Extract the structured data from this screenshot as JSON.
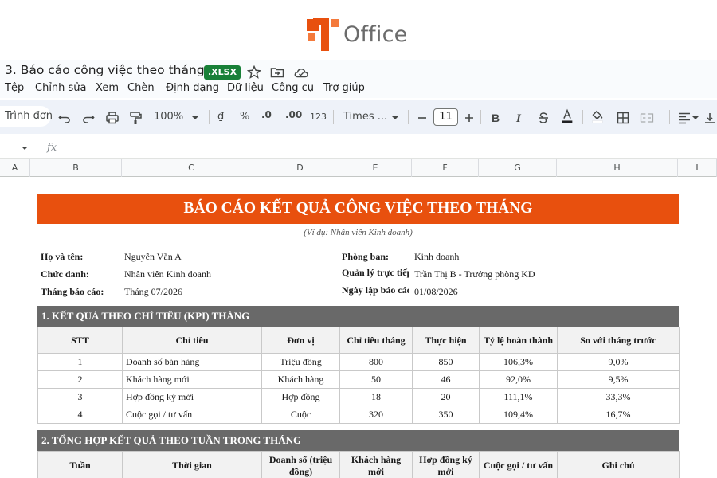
{
  "brand": {
    "name": "Office",
    "logo_color": "#e8500e"
  },
  "document": {
    "title": "3. Báo cáo công việc theo tháng",
    "badge": ".XLSX"
  },
  "menu": [
    "Tệp",
    "Chỉnh sửa",
    "Xem",
    "Chèn",
    "Định dạng",
    "Dữ liệu",
    "Công cụ",
    "Trợ giúp"
  ],
  "toolbar": {
    "mode": "Trình đơn",
    "zoom": "100%",
    "currency": "₫",
    "percent": "%",
    "dec_decrease": ".0",
    "dec_increase": ".00",
    "number_format": "123",
    "font": "Times ...",
    "font_size": "11"
  },
  "formula": {
    "fx": "fx"
  },
  "columns": [
    "A",
    "B",
    "C",
    "D",
    "E",
    "F",
    "G",
    "H",
    "I"
  ],
  "report": {
    "title": "BÁO CÁO KẾT QUẢ CÔNG VIỆC THEO THÁNG",
    "subtitle": "(Ví dụ: Nhân viên Kinh doanh)",
    "accent_color": "#e8500e",
    "info_left": [
      {
        "label": "Họ và tên:",
        "value": "Nguyễn Văn A"
      },
      {
        "label": "Chức danh:",
        "value": "Nhân viên Kinh doanh"
      },
      {
        "label": "Tháng báo cáo:",
        "value": "Tháng 07/2026"
      }
    ],
    "info_right": [
      {
        "label": "Phòng ban:",
        "value": "Kinh doanh"
      },
      {
        "label": "Quản lý trực tiếp:",
        "value": "Trần Thị B - Trưởng phòng KD"
      },
      {
        "label": "Ngày lập báo cáo:",
        "value": "01/08/2026"
      }
    ],
    "section1": {
      "title": "1. KẾT QUẢ THEO CHỈ TIÊU (KPI) THÁNG",
      "headers": [
        "STT",
        "Chỉ tiêu",
        "Đơn vị",
        "Chỉ tiêu tháng",
        "Thực hiện",
        "Tỷ lệ hoàn thành",
        "So với tháng trước"
      ],
      "rows": [
        [
          "1",
          "Doanh số bán hàng",
          "Triệu đồng",
          "800",
          "850",
          "106,3%",
          "9,0%"
        ],
        [
          "2",
          "Khách hàng mới",
          "Khách hàng",
          "50",
          "46",
          "92,0%",
          "9,5%"
        ],
        [
          "3",
          "Hợp đồng ký mới",
          "Hợp đồng",
          "18",
          "20",
          "111,1%",
          "33,3%"
        ],
        [
          "4",
          "Cuộc gọi / tư vấn",
          "Cuộc",
          "320",
          "350",
          "109,4%",
          "16,7%"
        ]
      ]
    },
    "section2": {
      "title": "2. TỔNG HỢP KẾT QUẢ THEO TUẦN TRONG THÁNG",
      "headers": [
        "Tuần",
        "Thời gian",
        "Doanh số (triệu đồng)",
        "Khách hàng mới",
        "Hợp đồng ký mới",
        "Cuộc gọi / tư vấn",
        "Ghi chú"
      ]
    }
  }
}
